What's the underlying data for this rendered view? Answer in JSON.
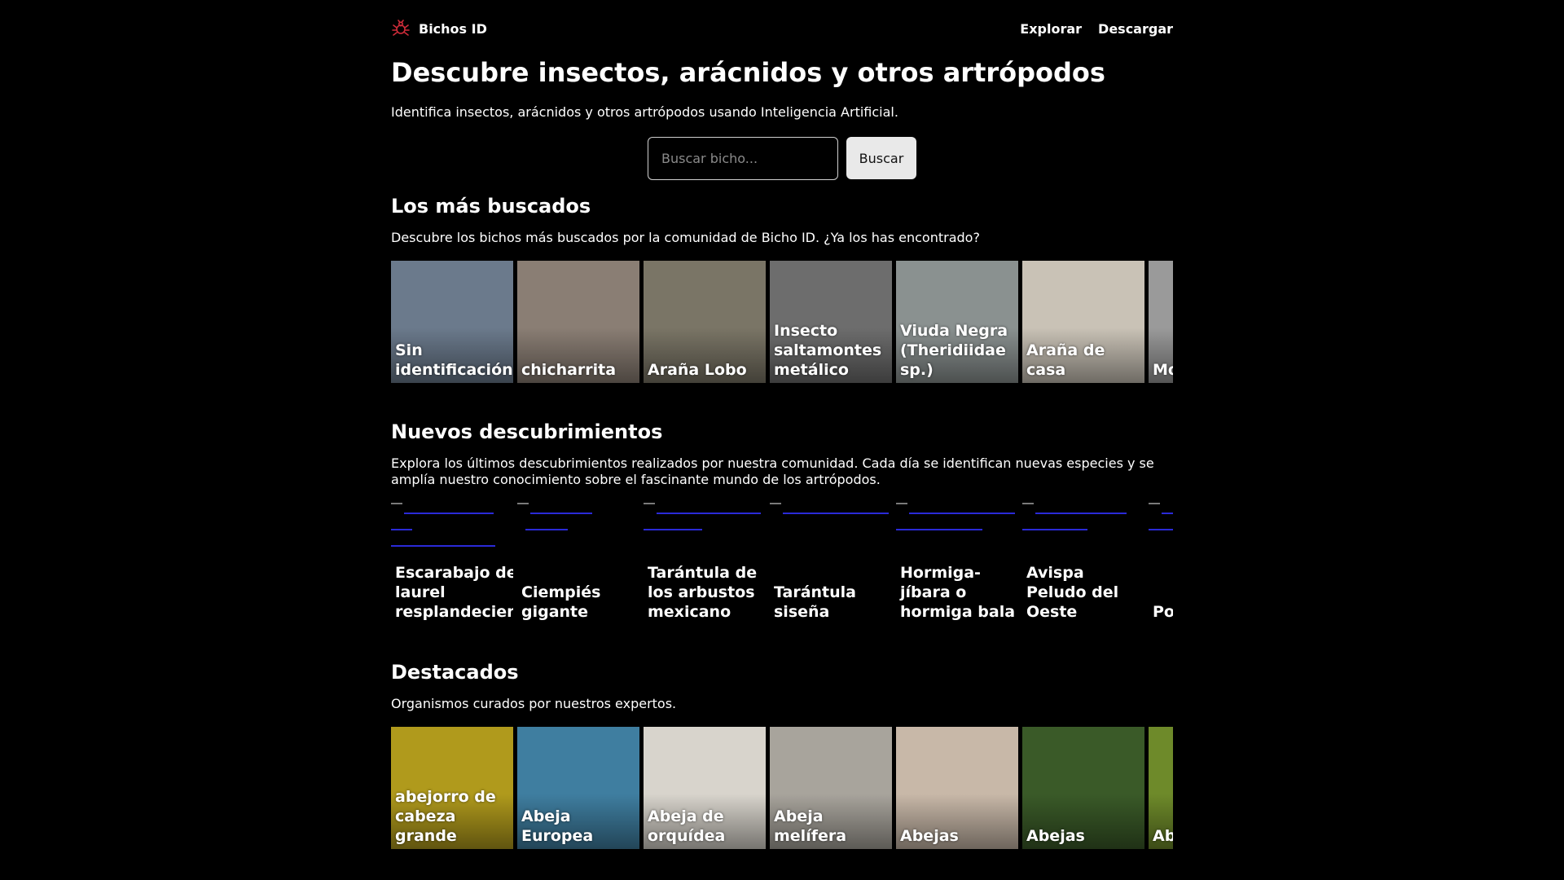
{
  "app": {
    "name": "Bichos ID",
    "nav": [
      "Explorar",
      "Descargar"
    ]
  },
  "hero": {
    "title": "Descubre insectos, arácnidos y otros artrópodos",
    "subtitle": "Identifica insectos, arácnidos y otros artrópodos usando Inteligencia Artificial.",
    "search_placeholder": "Buscar bicho...",
    "search_button": "Buscar"
  },
  "sections": [
    {
      "title": "Los más buscados",
      "text": "Descubre los bichos más buscados por la comunidad de Bicho ID. ¿Ya los has encontrado?",
      "cards": [
        {
          "label": "Sin identificación",
          "bg": "#6b7a8c"
        },
        {
          "label": "chicharrita",
          "bg": "#8a7e74"
        },
        {
          "label": "Araña Lobo",
          "bg": "#7a7566"
        },
        {
          "label": "Insecto saltamontes metálico",
          "bg": "#6d6d6d"
        },
        {
          "label": "Viuda Negra (Theridiidae sp.)",
          "bg": "#8a9190"
        },
        {
          "label": "Araña de casa",
          "bg": "#c9c2b6"
        },
        {
          "label": "Mo (C sp",
          "bg": "#9a9a9a"
        }
      ]
    },
    {
      "title": "Nuevos descubrimientos",
      "text": "Explora los últimos descubrimientos realizados por nuestra comunidad. Cada día se identifican nuevas especies y se amplía nuestro conocimiento sobre el fascinante mundo de los artrópodos.",
      "cards": [
        {
          "label": "Escarabajo de laurel resplandeciente"
        },
        {
          "label": "Ciempiés gigante"
        },
        {
          "label": "Tarántula de los arbustos mexicano"
        },
        {
          "label": "Tarántula siseña"
        },
        {
          "label": "Hormiga-jíbara o hormiga bala"
        },
        {
          "label": "Avispa Peludo del Oeste"
        },
        {
          "label": "Po co"
        }
      ]
    },
    {
      "title": "Destacados",
      "text": "Organismos curados por nuestros expertos.",
      "cards": [
        {
          "label": "abejorro de cabeza grande",
          "bg": "#b09a1c"
        },
        {
          "label": "Abeja Europea",
          "bg": "#3f7ea0"
        },
        {
          "label": "Abeja de orquídea",
          "bg": "#d8d4cc"
        },
        {
          "label": "Abeja melífera",
          "bg": "#a8a49c"
        },
        {
          "label": "Abejas",
          "bg": "#c8b8a8"
        },
        {
          "label": "Abejas",
          "bg": "#3a5a28"
        },
        {
          "label": "Ab",
          "bg": "#6e8a2a"
        }
      ]
    }
  ]
}
